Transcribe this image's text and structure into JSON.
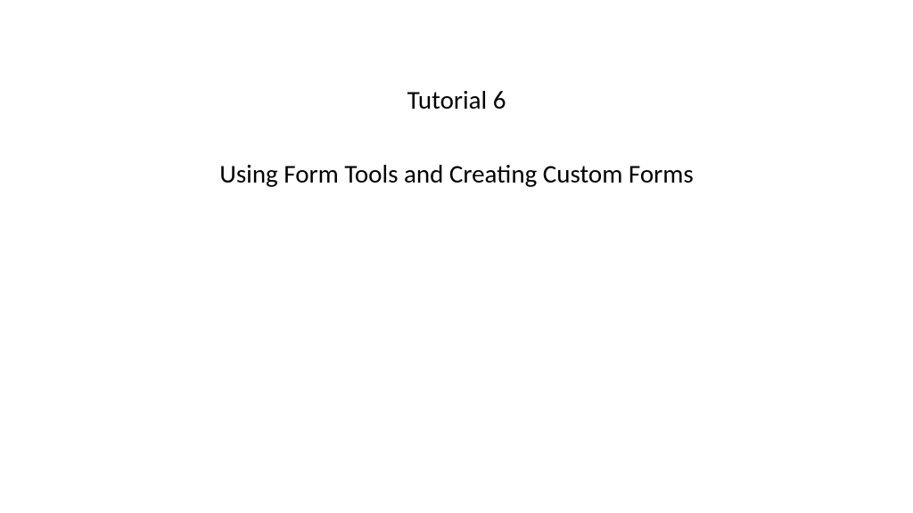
{
  "slide": {
    "title": "Tutorial 6",
    "subtitle": "Using Form Tools and Creating Custom Forms"
  }
}
